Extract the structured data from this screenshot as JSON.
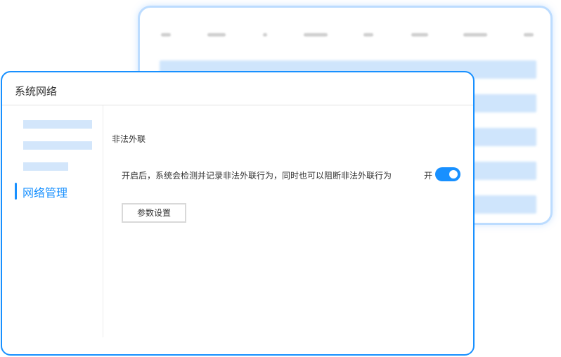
{
  "dialog": {
    "title": "系统网络"
  },
  "sidebar": {
    "active_item": "网络管理"
  },
  "content": {
    "section_title": "非法外联",
    "description": "开启后，系统会检测并记录非法外联行为，同时也可以阻断非法外联行为",
    "toggle": {
      "label": "开",
      "state": "on"
    },
    "settings_button": "参数设置"
  },
  "colors": {
    "accent": "#1890ff",
    "placeholder": "#d3e6fb"
  }
}
